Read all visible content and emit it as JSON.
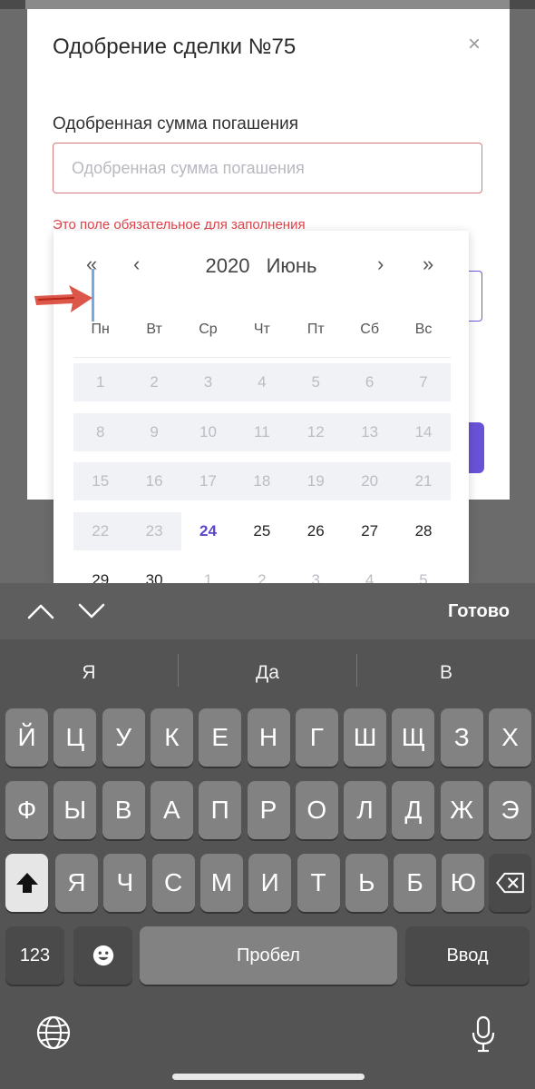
{
  "modal": {
    "title": "Одобрение сделки №75",
    "close_symbol": "×",
    "field_label": "Одобренная сумма погашения",
    "field_placeholder": "Одобренная сумма погашения",
    "field_error": "Это поле обязательное для заполнения"
  },
  "calendar": {
    "nav_prev_year": "«",
    "nav_prev_month": "‹",
    "nav_next_month": "›",
    "nav_next_year": "»",
    "year": "2020",
    "month": "Июнь",
    "weekdays": [
      "Пн",
      "Вт",
      "Ср",
      "Чт",
      "Пт",
      "Сб",
      "Вс"
    ],
    "weeks": [
      [
        {
          "d": "1",
          "s": "disabled"
        },
        {
          "d": "2",
          "s": "disabled"
        },
        {
          "d": "3",
          "s": "disabled"
        },
        {
          "d": "4",
          "s": "disabled"
        },
        {
          "d": "5",
          "s": "disabled"
        },
        {
          "d": "6",
          "s": "disabled"
        },
        {
          "d": "7",
          "s": "disabled"
        }
      ],
      [
        {
          "d": "8",
          "s": "disabled"
        },
        {
          "d": "9",
          "s": "disabled"
        },
        {
          "d": "10",
          "s": "disabled"
        },
        {
          "d": "11",
          "s": "disabled"
        },
        {
          "d": "12",
          "s": "disabled"
        },
        {
          "d": "13",
          "s": "disabled"
        },
        {
          "d": "14",
          "s": "disabled"
        }
      ],
      [
        {
          "d": "15",
          "s": "disabled"
        },
        {
          "d": "16",
          "s": "disabled"
        },
        {
          "d": "17",
          "s": "disabled"
        },
        {
          "d": "18",
          "s": "disabled"
        },
        {
          "d": "19",
          "s": "disabled"
        },
        {
          "d": "20",
          "s": "disabled"
        },
        {
          "d": "21",
          "s": "disabled"
        }
      ],
      [
        {
          "d": "22",
          "s": "disabled"
        },
        {
          "d": "23",
          "s": "disabled"
        },
        {
          "d": "24",
          "s": "today"
        },
        {
          "d": "25",
          "s": "normal"
        },
        {
          "d": "26",
          "s": "normal"
        },
        {
          "d": "27",
          "s": "normal"
        },
        {
          "d": "28",
          "s": "normal"
        }
      ],
      [
        {
          "d": "29",
          "s": "normal"
        },
        {
          "d": "30",
          "s": "normal"
        },
        {
          "d": "1",
          "s": "outside"
        },
        {
          "d": "2",
          "s": "outside"
        },
        {
          "d": "3",
          "s": "outside"
        },
        {
          "d": "4",
          "s": "outside"
        },
        {
          "d": "5",
          "s": "outside"
        }
      ]
    ]
  },
  "accessory": {
    "done_label": "Готово"
  },
  "keyboard": {
    "suggestions": [
      "Я",
      "Да",
      "В"
    ],
    "row1": [
      "Й",
      "Ц",
      "У",
      "К",
      "Е",
      "Н",
      "Г",
      "Ш",
      "Щ",
      "З",
      "Х"
    ],
    "row2": [
      "Ф",
      "Ы",
      "В",
      "А",
      "П",
      "Р",
      "О",
      "Л",
      "Д",
      "Ж",
      "Э"
    ],
    "row3": [
      "Я",
      "Ч",
      "С",
      "М",
      "И",
      "Т",
      "Ь",
      "Б",
      "Ю"
    ],
    "numbers_label": "123",
    "space_label": "Пробел",
    "enter_label": "Ввод"
  },
  "colors": {
    "accent": "#6a52d8",
    "error": "#e0444c",
    "today": "#5a47c7"
  }
}
